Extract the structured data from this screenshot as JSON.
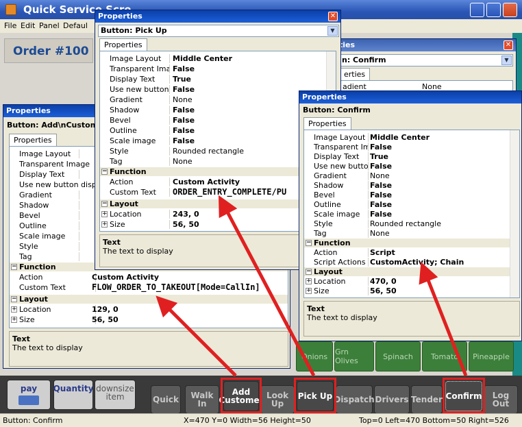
{
  "main_window": {
    "title": "Quick Service Scre",
    "menu": [
      "File",
      "Edit",
      "Panel",
      "Defaul"
    ],
    "order_label": "Order #100"
  },
  "behind_window": {
    "title": "ties",
    "combo": "n: Confirm",
    "tab": "erties",
    "row_name": "adient",
    "row_value": "None"
  },
  "green_buttons": [
    "Onions",
    "Grn Olives",
    "Spinach",
    "Tomato",
    "Pineapple"
  ],
  "toolbar_buttons": {
    "pay": "pay",
    "quantity": "Quantity",
    "downsize": "downsize\nitem",
    "quick": "Quick",
    "walkin": "Walk In",
    "addcustomer": "Add Customer",
    "lookup": "Look Up",
    "pickup": "Pick Up",
    "dispatch": "Dispatch",
    "drivers": "Drivers",
    "tender": "Tender",
    "confirm": "Confirm",
    "logout": "Log Out"
  },
  "status_bar": {
    "left": "Button: Confirm",
    "middle": "X=470 Y=0 Width=56 Height=50",
    "right": "Top=0 Left=470 Bottom=50 Right=526"
  },
  "prop_add": {
    "title": "Properties",
    "combo": "Button: Add\\nCustomer",
    "tab": "Properties",
    "rows": [
      {
        "name": "Image Layout",
        "value": ""
      },
      {
        "name": "Transparent Image",
        "value": ""
      },
      {
        "name": "Display Text",
        "value": ""
      },
      {
        "name": "Use new button displ",
        "value": ""
      },
      {
        "name": "Gradient",
        "value": ""
      },
      {
        "name": "Shadow",
        "value": ""
      },
      {
        "name": "Bevel",
        "value": ""
      },
      {
        "name": "Outline",
        "value": ""
      },
      {
        "name": "Scale image",
        "value": ""
      },
      {
        "name": "Style",
        "value": ""
      },
      {
        "name": "Tag",
        "value": ""
      }
    ],
    "cat_function": "Function",
    "action_name": "Action",
    "action_value": "Custom Activity",
    "custom_text_name": "Custom Text",
    "custom_text_value": "FLOW_ORDER_TO_TAKEOUT[Mode=CallIn]",
    "cat_layout": "Layout",
    "location_name": "Location",
    "location_value": "129, 0",
    "size_name": "Size",
    "size_value": "56, 50",
    "desc_title": "Text",
    "desc_text": "The text to display"
  },
  "prop_pickup": {
    "title": "Properties",
    "combo": "Button: Pick Up",
    "tab": "Properties",
    "rows": [
      {
        "name": "Image Layout",
        "value": "Middle Center",
        "bold": true
      },
      {
        "name": "Transparent Imag",
        "value": "False",
        "bold": true
      },
      {
        "name": "Display Text",
        "value": "True",
        "bold": true
      },
      {
        "name": "Use new button d",
        "value": "False",
        "bold": true
      },
      {
        "name": "Gradient",
        "value": "None",
        "bold": false
      },
      {
        "name": "Shadow",
        "value": "False",
        "bold": true
      },
      {
        "name": "Bevel",
        "value": "False",
        "bold": true
      },
      {
        "name": "Outline",
        "value": "False",
        "bold": true
      },
      {
        "name": "Scale image",
        "value": "False",
        "bold": true
      },
      {
        "name": "Style",
        "value": "Rounded rectangle",
        "bold": false
      },
      {
        "name": "Tag",
        "value": "None",
        "bold": false
      }
    ],
    "cat_function": "Function",
    "action_name": "Action",
    "action_value": "Custom Activity",
    "custom_text_name": "Custom Text",
    "custom_text_value": "ORDER_ENTRY_COMPLETE/PU",
    "cat_layout": "Layout",
    "location_name": "Location",
    "location_value": "243, 0",
    "size_name": "Size",
    "size_value": "56, 50",
    "desc_title": "Text",
    "desc_text": "The text to display"
  },
  "prop_confirm": {
    "title": "Properties",
    "combo": "Button: Confirm",
    "tab": "Properties",
    "rows": [
      {
        "name": "Image Layout",
        "value": "Middle Center",
        "bold": true
      },
      {
        "name": "Transparent Imag",
        "value": "False",
        "bold": true
      },
      {
        "name": "Display Text",
        "value": "True",
        "bold": true
      },
      {
        "name": "Use new button c",
        "value": "False",
        "bold": true
      },
      {
        "name": "Gradient",
        "value": "None",
        "bold": false
      },
      {
        "name": "Shadow",
        "value": "False",
        "bold": true
      },
      {
        "name": "Bevel",
        "value": "False",
        "bold": true
      },
      {
        "name": "Outline",
        "value": "False",
        "bold": true
      },
      {
        "name": "Scale image",
        "value": "False",
        "bold": true
      },
      {
        "name": "Style",
        "value": "Rounded rectangle",
        "bold": false
      },
      {
        "name": "Tag",
        "value": "None",
        "bold": false
      }
    ],
    "cat_function": "Function",
    "action_name": "Action",
    "action_value": "Script",
    "script_name": "Script Actions",
    "script_value": "CustomActivity; Chain",
    "cat_layout": "Layout",
    "location_name": "Location",
    "location_value": "470, 0",
    "size_name": "Size",
    "size_value": "56, 50",
    "desc_title": "Text",
    "desc_text": "The text to display"
  },
  "colors": {
    "highlight_box": "#E02020",
    "title_bar": "#2B56B6",
    "green_button": "#3C7F3A"
  }
}
